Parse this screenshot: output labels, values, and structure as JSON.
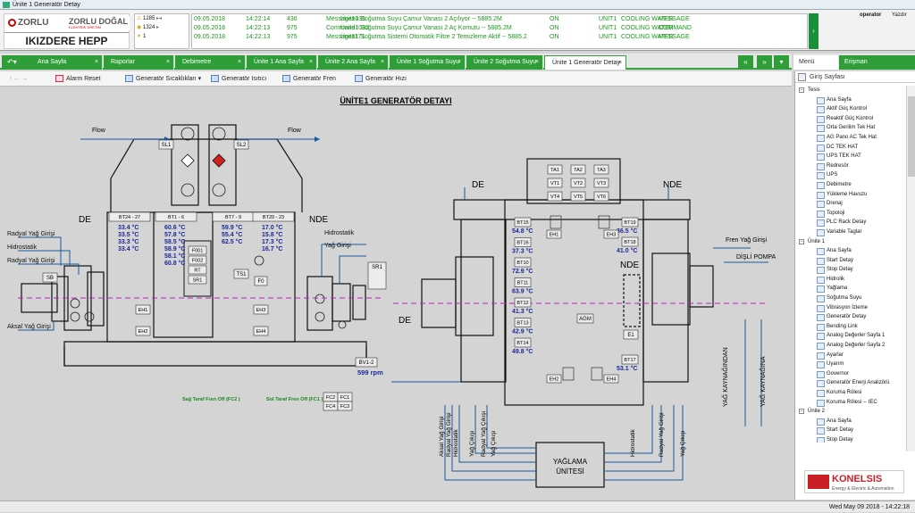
{
  "window": {
    "title": "Ünite 1 Generatör Detay"
  },
  "logo": {
    "brand": "ZORLU",
    "brand2": "ZORLU DOĞAL",
    "tagline": "ELEKTRİK ÜRETİM",
    "plant": "IKIZDERE HEPP"
  },
  "alarm_counts": {
    "warning": "1285",
    "active": "1324",
    "other": "1"
  },
  "messages": [
    {
      "date": "09.05.2018",
      "time": "14:22:14",
      "code": "436",
      "type": "Message1035",
      "text": "Ünite1 Soğutma Suyu Çamur Vanası 2 Açılıyor -- 5885.2M",
      "state": "ON",
      "unit": "UNIT1",
      "system": "COOLING WATER",
      "kind": "MESSAGE"
    },
    {
      "date": "09.05.2018",
      "time": "14:22:13",
      "code": "975",
      "type": "Command1033",
      "text": "Ünite1 Soğutma Suyu Çamur Vanası 2 Aç Komutu -- 5885.2M",
      "state": "ON",
      "unit": "UNIT1",
      "system": "COOLING WATER",
      "kind": "COMMAND"
    },
    {
      "date": "09.05.2018",
      "time": "14:22:13",
      "code": "975",
      "type": "Message1171",
      "text": "Ünite1 Soğutma Sistemi Otomatik Filtre 2 Temizleme Aktif -- 5885.2",
      "state": "ON",
      "unit": "UNIT1",
      "system": "COOLING WATER",
      "kind": "MESSAGE"
    }
  ],
  "user": {
    "name": "operator",
    "action": "Yazdır"
  },
  "tabs": [
    "Ana Sayfa",
    "Raporlar",
    "Debimetre",
    "Ünite 1 Ana Sayfa",
    "Ünite 2 Ana Sayfa",
    "Ünite 1 Soğutma Suyu",
    "Ünite 2 Soğutma Suyu",
    "Ünite 1 Generatör Detay"
  ],
  "active_tab": "Ünite 1 Generatör Detay",
  "right_tabs": {
    "menu": "Menü",
    "access": "Erişman"
  },
  "toolbar": {
    "alarm_reset": "Alarm Reset",
    "gen_temps": "Generatör Sıcaklıkları",
    "gen_heater": "Generatör Isıtıcı",
    "gen_brake": "Generatör Fren",
    "gen_speed": "Generatör Hızı"
  },
  "diagram": {
    "title": "ÜNİTE1 GENERATÖR DETAYI",
    "flow": "Flow",
    "de": "DE",
    "nde": "NDE",
    "sl1": "SL1",
    "sl2": "SL2",
    "bt_groups": [
      {
        "label": "BT24 - 27",
        "values": [
          "33.4 °C",
          "33.5 °C",
          "33.3 °C",
          "33.4 °C"
        ]
      },
      {
        "label": "BT1 - 6",
        "values": [
          "60.6 °C",
          "57.8 °C",
          "58.5 °C",
          "58.9 °C",
          "58.1 °C",
          "60.8 °C"
        ]
      },
      {
        "label": "BT7 - 9",
        "values": [
          "59.9 °C",
          "55.4 °C",
          "62.5 °C"
        ]
      },
      {
        "label": "BT20 - 23",
        "values": [
          "17.0 °C",
          "15.8 °C",
          "17.3 °C",
          "16.7 °C"
        ]
      }
    ],
    "fboxes": [
      "F001",
      "F002",
      "RT",
      "SR1"
    ],
    "eh": [
      "EH1",
      "EH2",
      "EH3",
      "EH4"
    ],
    "left_labels": [
      "Radyal Yağ Girişi",
      "Hidrostatik",
      "Radyal Yağ Girişi",
      "Aksal Yağ Girişi"
    ],
    "right_labels": [
      "Hidrostatik",
      "Yağ Girişi"
    ],
    "sb": "SB",
    "ts1": "TS1",
    "f0": "F0",
    "sr1": "SR1",
    "speed": {
      "tag": "BV1-2",
      "value": "599 rpm"
    },
    "brake_right": "Sağ Taraf Fren Off (FC2 )",
    "brake_left": "Sol Taraf Fren Off (FC1 )",
    "fc": [
      "FC2",
      "FC1",
      "FC4",
      "FC3"
    ],
    "ta": [
      "TA1",
      "TA2",
      "TA3"
    ],
    "vt": [
      "VT1",
      "VT2",
      "VT3"
    ],
    "vt2": [
      "VT4",
      "VT5",
      "VT6"
    ],
    "bt_right": [
      {
        "label": "BT15",
        "value": "54.8 °C"
      },
      {
        "label": "BT16",
        "value": "37.3 °C"
      },
      {
        "label": "BT10",
        "value": "72.9 °C"
      },
      {
        "label": "BT11",
        "value": "63.9 °C"
      },
      {
        "label": "BT12",
        "value": "41.3 °C"
      },
      {
        "label": "BT13",
        "value": "42.9 °C"
      },
      {
        "label": "BT14",
        "value": "49.8 °C"
      }
    ],
    "bt_nde": [
      {
        "label": "BT19",
        "value": "36.5 °C"
      },
      {
        "label": "BT18",
        "value": "41.0 °C"
      },
      {
        "label": "BT17",
        "value": "53.1 °C"
      }
    ],
    "agm": "AGM",
    "e1": "E1",
    "fren_label": "Fren Yağ Girişi",
    "pump": "DİŞLİ POMPA",
    "yag_kaynak1": "YAĞ KAYNAĞINDAN",
    "yag_kaynak2": "YAĞ KAYNAĞINA",
    "lube_unit": [
      "YAĞLAMA",
      "ÜNİTESİ"
    ],
    "bottom_labels": [
      "Aksal Yağ Girişi",
      "Radyal Yağ Girişi",
      "Hidrostatik",
      "Yağ Çıkışı",
      "Radyal Yağ Çıkışı",
      "Yağ Çıkışı",
      "Hidrostatik",
      "Radyal Yağ Girişi",
      "Yağ Çıkışı"
    ]
  },
  "sidebar": {
    "header": "Giriş Sayfası",
    "tree": [
      {
        "level": 0,
        "label": "Tesis"
      },
      {
        "level": 1,
        "label": "Ana Sayfa"
      },
      {
        "level": 1,
        "label": "Aktif Güç Kontrol"
      },
      {
        "level": 1,
        "label": "Reaktif Güç Kontrol"
      },
      {
        "level": 1,
        "label": "Orta Gerilim Tek Hat"
      },
      {
        "level": 1,
        "label": "AG Pano AC Tek Hat"
      },
      {
        "level": 1,
        "label": "DC TEK HAT"
      },
      {
        "level": 1,
        "label": "UPS TEK HAT"
      },
      {
        "level": 1,
        "label": "Redresör"
      },
      {
        "level": 1,
        "label": "UPS"
      },
      {
        "level": 1,
        "label": "Debimetre"
      },
      {
        "level": 1,
        "label": "Yükleme Havuzu"
      },
      {
        "level": 1,
        "label": "Drenaj"
      },
      {
        "level": 1,
        "label": "Topoloji"
      },
      {
        "level": 1,
        "label": "PLC Rack Detay"
      },
      {
        "level": 1,
        "label": "Variable Taglar"
      },
      {
        "level": 0,
        "label": "Ünite 1"
      },
      {
        "level": 1,
        "label": "Ana Sayfa"
      },
      {
        "level": 1,
        "label": "Start Detay"
      },
      {
        "level": 1,
        "label": "Stop Detay"
      },
      {
        "level": 1,
        "label": "Hidrolik"
      },
      {
        "level": 1,
        "label": "Yağlama"
      },
      {
        "level": 1,
        "label": "Soğutma Suyu"
      },
      {
        "level": 1,
        "label": "Vibrasyon İzleme"
      },
      {
        "level": 1,
        "label": "Generatör Detay"
      },
      {
        "level": 1,
        "label": "Bending Link"
      },
      {
        "level": 1,
        "label": "Analog Değerler Sayfa 1"
      },
      {
        "level": 1,
        "label": "Analog Değerler Sayfa 2"
      },
      {
        "level": 1,
        "label": "Ayarlar"
      },
      {
        "level": 1,
        "label": "Uyarım"
      },
      {
        "level": 1,
        "label": "Governor"
      },
      {
        "level": 1,
        "label": "Generatör Enerji Analizörü"
      },
      {
        "level": 1,
        "label": "Koruma Rölesi"
      },
      {
        "level": 1,
        "label": "Koruma Rölesi -- IEC"
      },
      {
        "level": 0,
        "label": "Ünite 2"
      },
      {
        "level": 1,
        "label": "Ana Sayfa"
      },
      {
        "level": 1,
        "label": "Start Detay"
      },
      {
        "level": 1,
        "label": "Stop Detay"
      }
    ]
  },
  "konelsis": {
    "name": "KONELSIS",
    "sub": "Energy & Electric & Automation"
  },
  "status": {
    "datetime": "Wed May 09 2018 - 14:22:18"
  },
  "colors": {
    "accent": "#2f9e38",
    "value_blue": "#1a2a9a",
    "alarm_red": "#d02020",
    "msg_green": "#1a9a1a"
  }
}
